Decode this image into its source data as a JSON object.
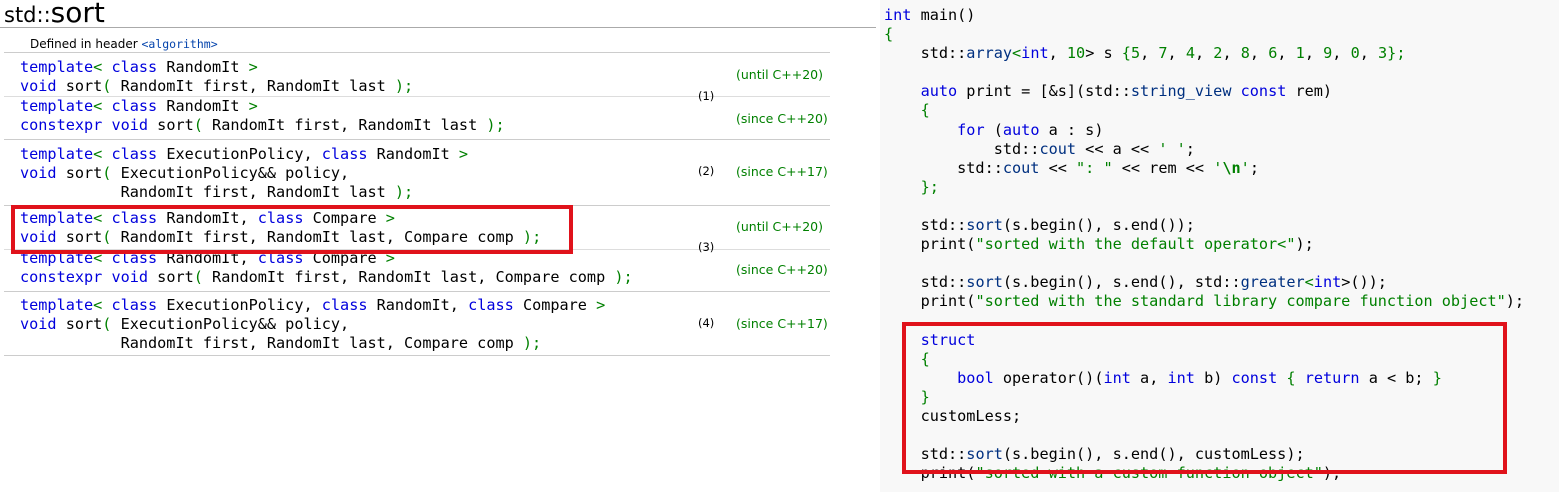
{
  "page": {
    "title_prefix": "std::",
    "title_name": "sort",
    "defined_in_label": "Defined in header ",
    "header_name": "<algorithm>"
  },
  "overloads": [
    {
      "number": "(1)",
      "variants": [
        {
          "lines": [
            [
              {
                "t": "template",
                "c": "kw"
              },
              {
                "t": "< ",
                "c": "pun"
              },
              {
                "t": "class",
                "c": "kw"
              },
              {
                "t": " RandomIt ",
                "c": "tx"
              },
              {
                "t": ">",
                "c": "pun"
              }
            ],
            [
              {
                "t": "void",
                "c": "kw"
              },
              {
                "t": " sort",
                "c": "tx"
              },
              {
                "t": "( ",
                "c": "pun"
              },
              {
                "t": "RandomIt first, RandomIt last ",
                "c": "tx"
              },
              {
                "t": ");",
                "c": "pun"
              }
            ]
          ],
          "version": "(until C++20)"
        },
        {
          "lines": [
            [
              {
                "t": "template",
                "c": "kw"
              },
              {
                "t": "< ",
                "c": "pun"
              },
              {
                "t": "class",
                "c": "kw"
              },
              {
                "t": " RandomIt ",
                "c": "tx"
              },
              {
                "t": ">",
                "c": "pun"
              }
            ],
            [
              {
                "t": "constexpr",
                "c": "kw"
              },
              {
                "t": " ",
                "c": "tx"
              },
              {
                "t": "void",
                "c": "kw"
              },
              {
                "t": " sort",
                "c": "tx"
              },
              {
                "t": "( ",
                "c": "pun"
              },
              {
                "t": "RandomIt first, RandomIt last ",
                "c": "tx"
              },
              {
                "t": ");",
                "c": "pun"
              }
            ]
          ],
          "version": "(since C++20)"
        }
      ]
    },
    {
      "number": "(2)",
      "variants": [
        {
          "lines": [
            [
              {
                "t": "template",
                "c": "kw"
              },
              {
                "t": "< ",
                "c": "pun"
              },
              {
                "t": "class",
                "c": "kw"
              },
              {
                "t": " ExecutionPolicy, ",
                "c": "tx"
              },
              {
                "t": "class",
                "c": "kw"
              },
              {
                "t": " RandomIt ",
                "c": "tx"
              },
              {
                "t": ">",
                "c": "pun"
              }
            ],
            [
              {
                "t": "void",
                "c": "kw"
              },
              {
                "t": " sort",
                "c": "tx"
              },
              {
                "t": "( ",
                "c": "pun"
              },
              {
                "t": "ExecutionPolicy&& policy,",
                "c": "tx"
              }
            ],
            [
              {
                "t": "           RandomIt first, RandomIt last ",
                "c": "tx"
              },
              {
                "t": ");",
                "c": "pun"
              }
            ]
          ],
          "version": "(since C++17)"
        }
      ]
    },
    {
      "number": "(3)",
      "variants": [
        {
          "lines": [
            [
              {
                "t": "template",
                "c": "kw"
              },
              {
                "t": "< ",
                "c": "pun"
              },
              {
                "t": "class",
                "c": "kw"
              },
              {
                "t": " RandomIt, ",
                "c": "tx"
              },
              {
                "t": "class",
                "c": "kw"
              },
              {
                "t": " Compare ",
                "c": "tx"
              },
              {
                "t": ">",
                "c": "pun"
              }
            ],
            [
              {
                "t": "void",
                "c": "kw"
              },
              {
                "t": " sort",
                "c": "tx"
              },
              {
                "t": "( ",
                "c": "pun"
              },
              {
                "t": "RandomIt first, RandomIt last, Compare comp ",
                "c": "tx"
              },
              {
                "t": ");",
                "c": "pun"
              }
            ]
          ],
          "version": "(until C++20)"
        },
        {
          "lines": [
            [
              {
                "t": "template",
                "c": "kw"
              },
              {
                "t": "< ",
                "c": "pun"
              },
              {
                "t": "class",
                "c": "kw"
              },
              {
                "t": " RandomIt, ",
                "c": "tx"
              },
              {
                "t": "class",
                "c": "kw"
              },
              {
                "t": " Compare ",
                "c": "tx"
              },
              {
                "t": ">",
                "c": "pun"
              }
            ],
            [
              {
                "t": "constexpr",
                "c": "kw"
              },
              {
                "t": " ",
                "c": "tx"
              },
              {
                "t": "void",
                "c": "kw"
              },
              {
                "t": " sort",
                "c": "tx"
              },
              {
                "t": "( ",
                "c": "pun"
              },
              {
                "t": "RandomIt first, RandomIt last, Compare comp ",
                "c": "tx"
              },
              {
                "t": ");",
                "c": "pun"
              }
            ]
          ],
          "version": "(since C++20)"
        }
      ]
    },
    {
      "number": "(4)",
      "variants": [
        {
          "lines": [
            [
              {
                "t": "template",
                "c": "kw"
              },
              {
                "t": "< ",
                "c": "pun"
              },
              {
                "t": "class",
                "c": "kw"
              },
              {
                "t": " ExecutionPolicy, ",
                "c": "tx"
              },
              {
                "t": "class",
                "c": "kw"
              },
              {
                "t": " RandomIt, ",
                "c": "tx"
              },
              {
                "t": "class",
                "c": "kw"
              },
              {
                "t": " Compare ",
                "c": "tx"
              },
              {
                "t": ">",
                "c": "pun"
              }
            ],
            [
              {
                "t": "void",
                "c": "kw"
              },
              {
                "t": " sort",
                "c": "tx"
              },
              {
                "t": "( ",
                "c": "pun"
              },
              {
                "t": "ExecutionPolicy&& policy,",
                "c": "tx"
              }
            ],
            [
              {
                "t": "           RandomIt first, RandomIt last, Compare comp ",
                "c": "tx"
              },
              {
                "t": ");",
                "c": "pun"
              }
            ]
          ],
          "version": "(since C++17)"
        }
      ]
    }
  ],
  "code_example": [
    [
      {
        "t": "int",
        "c": "ck"
      },
      {
        "t": " main()",
        "c": "tx"
      }
    ],
    [
      {
        "t": "{",
        "c": "cs"
      }
    ],
    [
      {
        "t": "    std::",
        "c": "tx"
      },
      {
        "t": "array",
        "c": "cfn"
      },
      {
        "t": "<",
        "c": "cs"
      },
      {
        "t": "int",
        "c": "ck"
      },
      {
        "t": ", ",
        "c": "tx"
      },
      {
        "t": "10",
        "c": "cn"
      },
      {
        "t": "> s ",
        "c": "tx"
      },
      {
        "t": "{",
        "c": "cs"
      },
      {
        "t": "5",
        "c": "cn"
      },
      {
        "t": ", ",
        "c": "tx"
      },
      {
        "t": "7",
        "c": "cn"
      },
      {
        "t": ", ",
        "c": "tx"
      },
      {
        "t": "4",
        "c": "cn"
      },
      {
        "t": ", ",
        "c": "tx"
      },
      {
        "t": "2",
        "c": "cn"
      },
      {
        "t": ", ",
        "c": "tx"
      },
      {
        "t": "8",
        "c": "cn"
      },
      {
        "t": ", ",
        "c": "tx"
      },
      {
        "t": "6",
        "c": "cn"
      },
      {
        "t": ", ",
        "c": "tx"
      },
      {
        "t": "1",
        "c": "cn"
      },
      {
        "t": ", ",
        "c": "tx"
      },
      {
        "t": "9",
        "c": "cn"
      },
      {
        "t": ", ",
        "c": "tx"
      },
      {
        "t": "0",
        "c": "cn"
      },
      {
        "t": ", ",
        "c": "tx"
      },
      {
        "t": "3",
        "c": "cn"
      },
      {
        "t": "};",
        "c": "cs"
      }
    ],
    [],
    [
      {
        "t": "    ",
        "c": "tx"
      },
      {
        "t": "auto",
        "c": "ck"
      },
      {
        "t": " print = [&s](std::",
        "c": "tx"
      },
      {
        "t": "string_view",
        "c": "cfn"
      },
      {
        "t": " ",
        "c": "tx"
      },
      {
        "t": "const",
        "c": "ck"
      },
      {
        "t": " rem)",
        "c": "tx"
      }
    ],
    [
      {
        "t": "    {",
        "c": "cs"
      }
    ],
    [
      {
        "t": "        ",
        "c": "tx"
      },
      {
        "t": "for",
        "c": "ck"
      },
      {
        "t": " (",
        "c": "tx"
      },
      {
        "t": "auto",
        "c": "ck"
      },
      {
        "t": " a : s)",
        "c": "tx"
      }
    ],
    [
      {
        "t": "            std::",
        "c": "tx"
      },
      {
        "t": "cout",
        "c": "cfn"
      },
      {
        "t": " << a << ",
        "c": "tx"
      },
      {
        "t": "' '",
        "c": "cs"
      },
      {
        "t": ";",
        "c": "tx"
      }
    ],
    [
      {
        "t": "        std::",
        "c": "tx"
      },
      {
        "t": "cout",
        "c": "cfn"
      },
      {
        "t": " << ",
        "c": "tx"
      },
      {
        "t": "\": \"",
        "c": "cs"
      },
      {
        "t": " << rem << ",
        "c": "tx"
      },
      {
        "t": "'",
        "c": "cs"
      },
      {
        "t": "\\n",
        "c": "cesc"
      },
      {
        "t": "'",
        "c": "cs"
      },
      {
        "t": ";",
        "c": "tx"
      }
    ],
    [
      {
        "t": "    };",
        "c": "cs"
      }
    ],
    [],
    [
      {
        "t": "    std::",
        "c": "tx"
      },
      {
        "t": "sort",
        "c": "cfn"
      },
      {
        "t": "(s.begin(), s.end());",
        "c": "tx"
      }
    ],
    [
      {
        "t": "    print(",
        "c": "tx"
      },
      {
        "t": "\"sorted with the default operator<\"",
        "c": "cs"
      },
      {
        "t": ");",
        "c": "tx"
      }
    ],
    [],
    [
      {
        "t": "    std::",
        "c": "tx"
      },
      {
        "t": "sort",
        "c": "cfn"
      },
      {
        "t": "(s.begin(), s.end(), std::",
        "c": "tx"
      },
      {
        "t": "greater",
        "c": "cfn"
      },
      {
        "t": "<",
        "c": "cs"
      },
      {
        "t": "int",
        "c": "ck"
      },
      {
        "t": ">());",
        "c": "tx"
      }
    ],
    [
      {
        "t": "    print(",
        "c": "tx"
      },
      {
        "t": "\"sorted with the standard library compare function object\"",
        "c": "cs"
      },
      {
        "t": ");",
        "c": "tx"
      }
    ],
    [],
    [
      {
        "t": "    ",
        "c": "tx"
      },
      {
        "t": "struct",
        "c": "ck"
      }
    ],
    [
      {
        "t": "    {",
        "c": "cs"
      }
    ],
    [
      {
        "t": "        ",
        "c": "tx"
      },
      {
        "t": "bool",
        "c": "ck"
      },
      {
        "t": " operator()(",
        "c": "tx"
      },
      {
        "t": "int",
        "c": "ck"
      },
      {
        "t": " a, ",
        "c": "tx"
      },
      {
        "t": "int",
        "c": "ck"
      },
      {
        "t": " b) ",
        "c": "tx"
      },
      {
        "t": "const",
        "c": "ck"
      },
      {
        "t": " ",
        "c": "tx"
      },
      {
        "t": "{",
        "c": "cs"
      },
      {
        "t": " ",
        "c": "tx"
      },
      {
        "t": "return",
        "c": "ck"
      },
      {
        "t": " a < b; ",
        "c": "tx"
      },
      {
        "t": "}",
        "c": "cs"
      }
    ],
    [
      {
        "t": "    }",
        "c": "cs"
      }
    ],
    [
      {
        "t": "    customLess;",
        "c": "tx"
      }
    ],
    [],
    [
      {
        "t": "    std::",
        "c": "tx"
      },
      {
        "t": "sort",
        "c": "cfn"
      },
      {
        "t": "(s.begin(), s.end(), customLess);",
        "c": "tx"
      }
    ],
    [
      {
        "t": "    print(",
        "c": "tx"
      },
      {
        "t": "\"sorted with a custom function object\"",
        "c": "cs"
      },
      {
        "t": ");",
        "c": "tx"
      }
    ]
  ],
  "highlight_color": "#e0121b"
}
